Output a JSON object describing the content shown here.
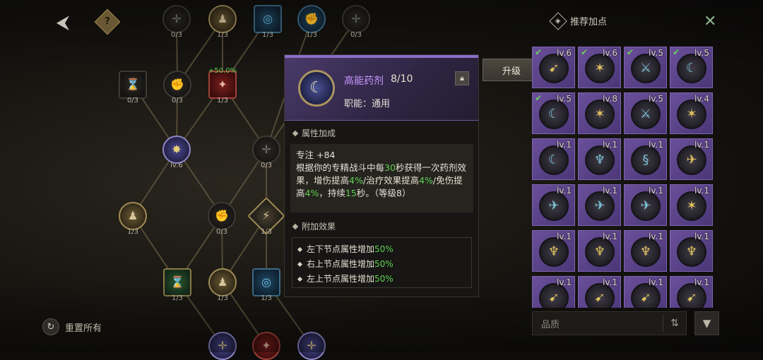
{
  "top": {
    "back_icon": "back-arrow-icon",
    "help_icon": "help-icon",
    "help_glyph": "?"
  },
  "tree": {
    "labels": [
      "0/3",
      "1/3",
      "1/3",
      "1/3",
      "0/3",
      "+50.0%",
      "0/3",
      "0/3",
      "1/3",
      "lv.6",
      "0/3",
      "1/3",
      "0/3",
      "1/3",
      "1/3",
      "1/3",
      "1/3"
    ]
  },
  "tooltip": {
    "name": "高能药剂",
    "level": "8/10",
    "role": "职能：通用",
    "lock_icon": "lock-icon",
    "attr_title": "属性加成",
    "attr_stat": "专注 +84",
    "desc_parts": [
      "根据你的专精战斗中每",
      "30",
      "秒获得一次药剂效果，增伤提高",
      "4%",
      "/治疗效果提高",
      "4%",
      "/免伤提高",
      "4%",
      "，持续",
      "15",
      "秒。（等级8）"
    ],
    "bonus_title": "附加效果",
    "bonus_items": [
      {
        "text": "左下节点属性增加",
        "value": "50%"
      },
      {
        "text": "右上节点属性增加",
        "value": "50%"
      },
      {
        "text": "左上节点属性增加",
        "value": "50%"
      }
    ]
  },
  "upgrade_label": "升级",
  "reset_label": "重置所有",
  "right_panel": {
    "title": "推荐加点",
    "close_icon": "close-icon",
    "quality_placeholder": "品质",
    "sort_icon": "sort-icon",
    "filter_icon": "filter-icon",
    "cells": [
      {
        "lv": "lv.6",
        "check": true,
        "icon": "arrow-icon",
        "tone": "gold"
      },
      {
        "lv": "lv.6",
        "check": true,
        "icon": "spike-icon",
        "tone": "gold"
      },
      {
        "lv": "lv.5",
        "check": true,
        "icon": "claw-icon",
        "tone": "blue"
      },
      {
        "lv": "lv.5",
        "check": true,
        "icon": "swirl-icon",
        "tone": "blue"
      },
      {
        "lv": "lv.5",
        "check": true,
        "icon": "swirl-icon",
        "tone": "blue"
      },
      {
        "lv": "lv.8",
        "check": false,
        "icon": "spike-icon",
        "tone": "gold"
      },
      {
        "lv": "lv.5",
        "check": false,
        "icon": "claw-icon",
        "tone": "blue"
      },
      {
        "lv": "lv.4",
        "check": false,
        "icon": "spike-icon",
        "tone": "gold"
      },
      {
        "lv": "lv.1",
        "check": false,
        "icon": "swirl-icon",
        "tone": "blue"
      },
      {
        "lv": "lv.1",
        "check": false,
        "icon": "wing-icon",
        "tone": "blue"
      },
      {
        "lv": "lv.1",
        "check": false,
        "icon": "serpent-icon",
        "tone": "blue"
      },
      {
        "lv": "lv.1",
        "check": false,
        "icon": "bird-icon",
        "tone": "gold"
      },
      {
        "lv": "lv.1",
        "check": false,
        "icon": "bird-icon",
        "tone": "blue"
      },
      {
        "lv": "lv.1",
        "check": false,
        "icon": "bird-icon",
        "tone": "blue"
      },
      {
        "lv": "lv.1",
        "check": false,
        "icon": "bird-icon",
        "tone": "blue"
      },
      {
        "lv": "lv.1",
        "check": false,
        "icon": "spike-icon",
        "tone": "gold"
      },
      {
        "lv": "lv.1",
        "check": false,
        "icon": "trident-icon",
        "tone": "gold"
      },
      {
        "lv": "lv.1",
        "check": false,
        "icon": "trident-icon",
        "tone": "gold"
      },
      {
        "lv": "lv.1",
        "check": false,
        "icon": "trident-icon",
        "tone": "gold"
      },
      {
        "lv": "lv.1",
        "check": false,
        "icon": "trident-icon",
        "tone": "gold"
      },
      {
        "lv": "lv.1",
        "check": false,
        "icon": "arrow-icon",
        "tone": "gold"
      },
      {
        "lv": "lv.1",
        "check": false,
        "icon": "arrow-icon",
        "tone": "gold"
      },
      {
        "lv": "lv.1",
        "check": false,
        "icon": "arrow-icon",
        "tone": "gold"
      },
      {
        "lv": "lv.1",
        "check": false,
        "icon": "arrow-icon",
        "tone": "gold"
      }
    ]
  }
}
